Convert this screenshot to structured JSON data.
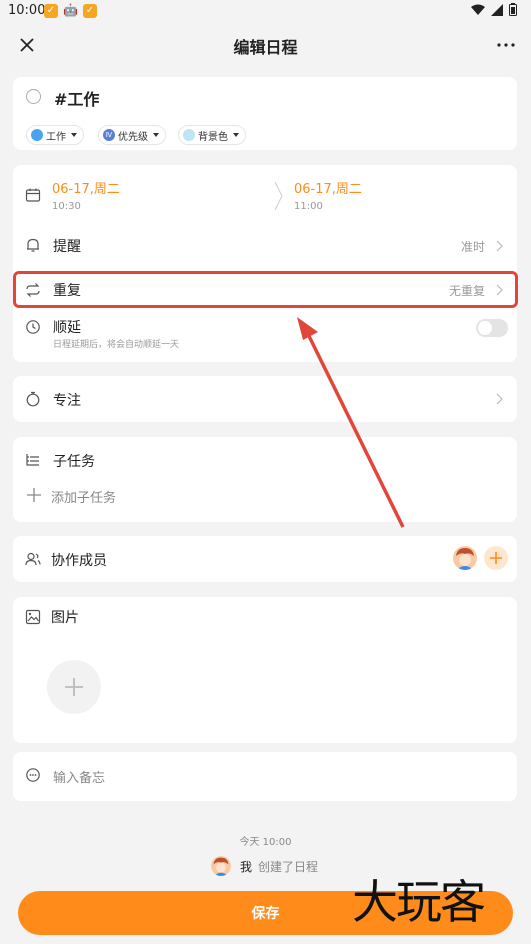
{
  "status_bar": {
    "time": "10:00"
  },
  "header": {
    "title": "编辑日程"
  },
  "task": {
    "title": "#工作",
    "chips": [
      {
        "label": "工作",
        "color": "#4aa3f0"
      },
      {
        "label": "优先级",
        "color": "#5b7fd6",
        "badge": "Ⅳ"
      },
      {
        "label": "背景色",
        "color": "#bfe3f7"
      }
    ]
  },
  "schedule": {
    "start_date": "06-17,周二",
    "start_time": "10:30",
    "end_date": "06-17,周二",
    "end_time": "11:00",
    "reminder_label": "提醒",
    "reminder_value": "准时",
    "repeat_label": "重复",
    "repeat_value": "无重复",
    "postpone_label": "顺延",
    "postpone_desc": "日程延期后，将会自动顺延一天",
    "postpone_enabled": false
  },
  "focus": {
    "label": "专注"
  },
  "subtasks": {
    "label": "子任务",
    "add_label": "添加子任务"
  },
  "members": {
    "label": "协作成员"
  },
  "images": {
    "label": "图片"
  },
  "note": {
    "placeholder": "输入备忘"
  },
  "activity": {
    "time": "今天 10:00",
    "user": "我",
    "action": "创建了日程"
  },
  "footer": {
    "save_label": "保存"
  },
  "watermark": {
    "text": "大玩客"
  },
  "colors": {
    "accent": "#ff8c1a",
    "highlight": "#e0473a",
    "arrow": "#e0473a"
  }
}
